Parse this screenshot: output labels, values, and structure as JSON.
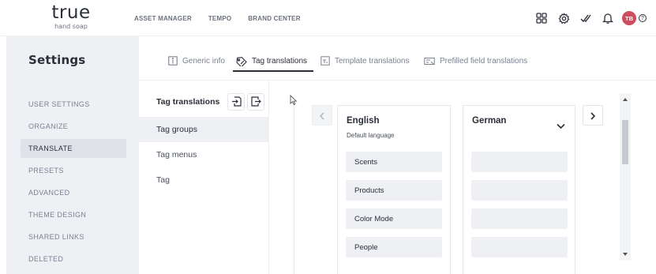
{
  "brand": {
    "name": "true",
    "tagline": "hand soap"
  },
  "topnav": {
    "links": [
      "ASSET MANAGER",
      "TEMPO",
      "BRAND CENTER"
    ],
    "icons": [
      "apps-grid-icon",
      "gear-icon",
      "double-check-icon",
      "bell-icon"
    ],
    "avatar_initials": "TB",
    "avatar_color": "#cc4d5f",
    "help_label": "?"
  },
  "sidebar": {
    "title": "Settings",
    "items": [
      {
        "label": "USER SETTINGS",
        "active": false
      },
      {
        "label": "ORGANIZE",
        "active": false
      },
      {
        "label": "TRANSLATE",
        "active": true
      },
      {
        "label": "PRESETS",
        "active": false
      },
      {
        "label": "ADVANCED",
        "active": false
      },
      {
        "label": "THEME DESIGN",
        "active": false
      },
      {
        "label": "SHARED LINKS",
        "active": false
      },
      {
        "label": "DELETED",
        "active": false
      }
    ]
  },
  "tabs": [
    {
      "label": "Generic info",
      "icon": "info-icon",
      "active": false
    },
    {
      "label": "Tag translations",
      "icon": "tag-icon",
      "active": true
    },
    {
      "label": "Template translations",
      "icon": "template-icon",
      "active": false
    },
    {
      "label": "Prefilled field translations",
      "icon": "field-icon",
      "active": false
    }
  ],
  "sublist": {
    "heading": "Tag translations",
    "actions": [
      "import-icon",
      "export-icon"
    ],
    "items": [
      {
        "label": "Tag groups",
        "active": true
      },
      {
        "label": "Tag menus",
        "active": false
      },
      {
        "label": "Tag",
        "active": false
      }
    ]
  },
  "translation": {
    "source": {
      "language": "English",
      "subtitle": "Default language",
      "tags": [
        "Scents",
        "Products",
        "Color Mode",
        "People"
      ]
    },
    "target": {
      "language": "German",
      "values": [
        "",
        "",
        "",
        ""
      ]
    }
  }
}
